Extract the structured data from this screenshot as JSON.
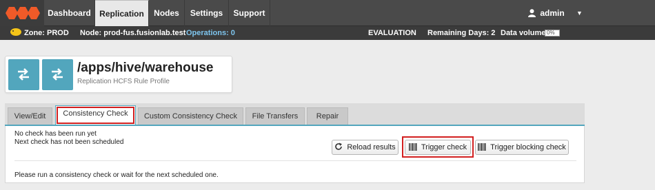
{
  "nav": {
    "items": [
      {
        "label": "Dashboard",
        "active": false
      },
      {
        "label": "Replication",
        "active": true
      },
      {
        "label": "Nodes",
        "active": false
      },
      {
        "label": "Settings",
        "active": false
      },
      {
        "label": "Support",
        "active": false
      }
    ],
    "user": "admin"
  },
  "status": {
    "zone": "Zone: PROD",
    "node": "Node: prod-fus.fusionlab.test",
    "operations": "Operations: 0",
    "license": "EVALUATION",
    "remaining": "Remaining Days: 2",
    "volume_label": "Data volume:",
    "volume_value": "0%",
    "volume_fraction": 0
  },
  "header": {
    "title": "/apps/hive/warehouse",
    "subtitle": "Replication HCFS Rule Profile"
  },
  "tabs": [
    {
      "label": "View/Edit",
      "active": false
    },
    {
      "label": "Consistency Check",
      "active": true
    },
    {
      "label": "Custom Consistency Check",
      "active": false
    },
    {
      "label": "File Transfers",
      "active": false
    },
    {
      "label": "Repair",
      "active": false
    }
  ],
  "panel": {
    "line1": "No check has been run yet",
    "line2": "Next check has not been scheduled",
    "reload_label": "Reload results",
    "trigger_label": "Trigger check",
    "blocking_label": "Trigger blocking check",
    "footer_msg": "Please run a consistency check or wait for the next scheduled one."
  },
  "colors": {
    "accent": "#52a6bd",
    "highlight": "#d21f1f",
    "logo": "#f05a28",
    "nav_bg": "#4a4a4a"
  }
}
